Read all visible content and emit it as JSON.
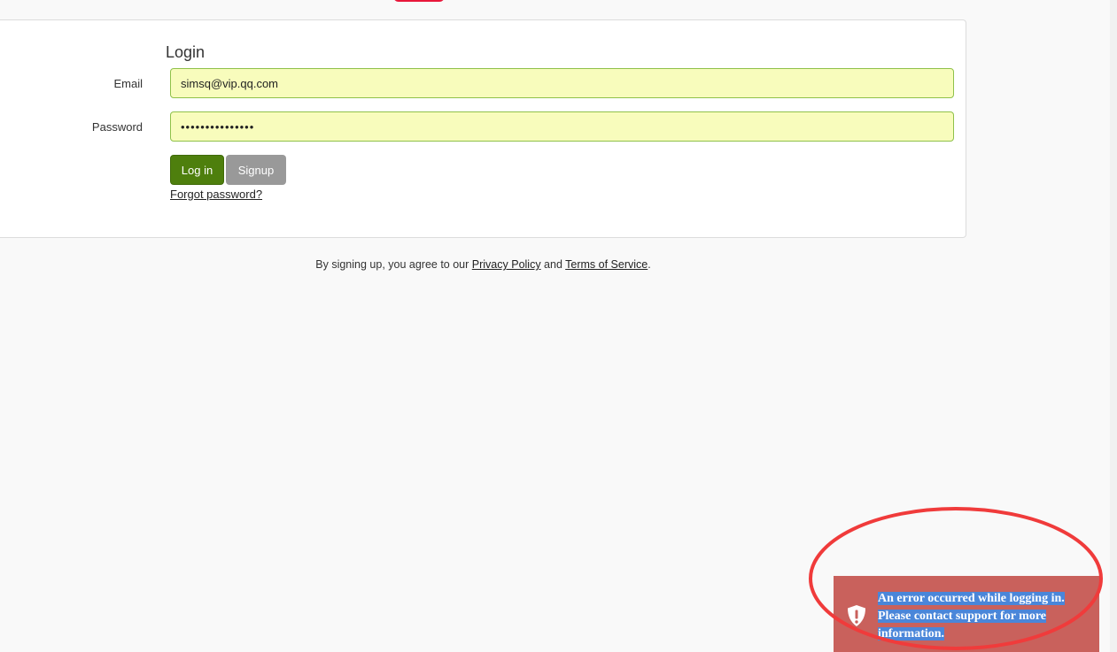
{
  "login": {
    "title": "Login",
    "email_label": "Email",
    "email_value": "simsq@vip.qq.com",
    "password_label": "Password",
    "password_value": "***************",
    "login_button": "Log in",
    "signup_button": "Signup",
    "forgot_link": "Forgot password?"
  },
  "agreement": {
    "prefix": "By signing up, you agree to our ",
    "privacy_link": "Privacy Policy",
    "middle": " and ",
    "terms_link": "Terms of Service",
    "suffix": "."
  },
  "toast": {
    "icon": "shield-exclamation-icon",
    "message": "An error occurred while logging in. Please contact support for more information.",
    "background": "#c9615c"
  },
  "colors": {
    "primary_button": "#4e7f0d",
    "secondary_button": "#999999",
    "input_background": "#f8fcbc",
    "input_border": "#8fc14a",
    "annotation": "#f03b3b"
  }
}
